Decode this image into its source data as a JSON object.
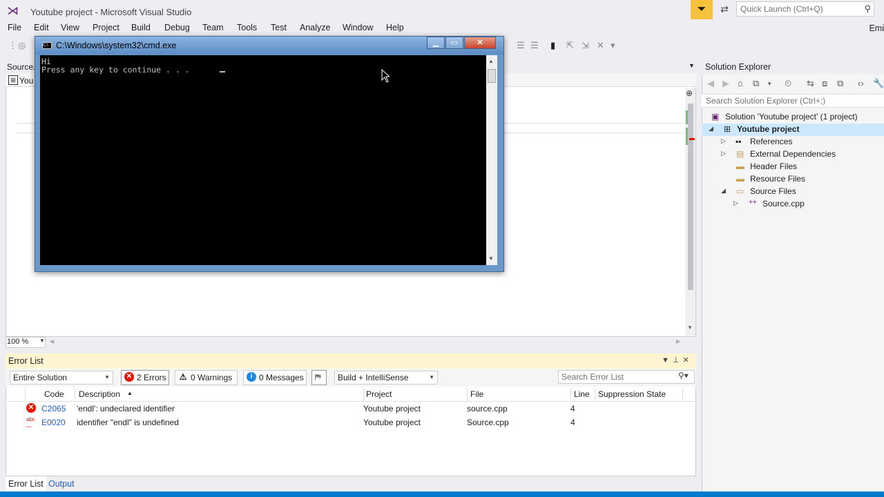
{
  "window": {
    "title": "Youtube project - Microsoft Visual Studio",
    "quick_launch_placeholder": "Quick Launch (Ctrl+Q)",
    "user": "Emi"
  },
  "menu": [
    "File",
    "Edit",
    "View",
    "Project",
    "Build",
    "Debug",
    "Team",
    "Tools",
    "Test",
    "Analyze",
    "Window",
    "Help"
  ],
  "editor": {
    "tab_label": "Source.",
    "nav_label": "You",
    "zoom": "100 %"
  },
  "console": {
    "title": "C:\\Windows\\system32\\cmd.exe",
    "lines": [
      "Hi",
      "Press any key to continue . . . "
    ]
  },
  "solution_explorer": {
    "title": "Solution Explorer",
    "search_placeholder": "Search Solution Explorer (Ctrl+;)",
    "tree": [
      {
        "label": "Solution 'Youtube project' (1 project)"
      },
      {
        "label": "Youtube project"
      },
      {
        "label": "References"
      },
      {
        "label": "External Dependencies"
      },
      {
        "label": "Header Files"
      },
      {
        "label": "Resource Files"
      },
      {
        "label": "Source Files"
      },
      {
        "label": "Source.cpp"
      }
    ]
  },
  "error_list": {
    "title": "Error List",
    "scope": "Entire Solution",
    "errors_chip": "2 Errors",
    "warnings_chip": "0 Warnings",
    "messages_chip": "0 Messages",
    "build_filter": "Build + IntelliSense",
    "search_placeholder": "Search Error List",
    "columns": [
      "Code",
      "Description",
      "Project",
      "File",
      "Line",
      "Suppression State"
    ],
    "rows": [
      {
        "code": "C2065",
        "description": "'endl': undeclared identifier",
        "project": "Youtube project",
        "file": "source.cpp",
        "line": "4",
        "suppression": ""
      },
      {
        "code": "E0020",
        "description": "identifier \"endl\" is undefined",
        "project": "Youtube project",
        "file": "Source.cpp",
        "line": "4",
        "suppression": ""
      }
    ]
  },
  "bottom_tabs": [
    "Error List",
    "Output"
  ],
  "colors": {
    "accent": "#007acc",
    "error_red": "#e51400",
    "warning_yellow": "#f5c33b",
    "info_blue": "#1e88e5"
  }
}
